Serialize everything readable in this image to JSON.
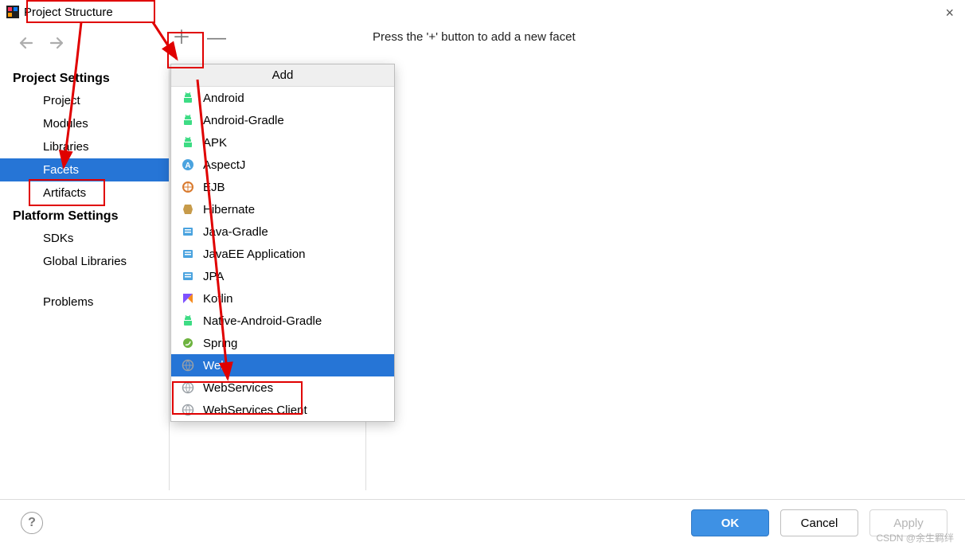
{
  "window": {
    "title": "Project Structure",
    "close_icon": "×"
  },
  "hint": "Press the '+' button to add a new facet",
  "sidebar": {
    "project_settings_heading": "Project Settings",
    "project": "Project",
    "modules": "Modules",
    "libraries": "Libraries",
    "facets": "Facets",
    "artifacts": "Artifacts",
    "platform_settings_heading": "Platform Settings",
    "sdks": "SDKs",
    "global_libraries": "Global Libraries",
    "problems": "Problems"
  },
  "popup": {
    "title": "Add",
    "items": [
      {
        "label": "Android",
        "icon_color": "#3ddc84",
        "icon": "android"
      },
      {
        "label": "Android-Gradle",
        "icon_color": "#3ddc84",
        "icon": "android"
      },
      {
        "label": "APK",
        "icon_color": "#3ddc84",
        "icon": "android"
      },
      {
        "label": "AspectJ",
        "icon_color": "#4aa3df",
        "icon": "letter-a"
      },
      {
        "label": "EJB",
        "icon_color": "#d97a2e",
        "icon": "ejb"
      },
      {
        "label": "Hibernate",
        "icon_color": "#c79b4a",
        "icon": "hibernate"
      },
      {
        "label": "Java-Gradle",
        "icon_color": "#4aa3df",
        "icon": "gradle"
      },
      {
        "label": "JavaEE Application",
        "icon_color": "#4aa3df",
        "icon": "javaee"
      },
      {
        "label": "JPA",
        "icon_color": "#4aa3df",
        "icon": "jpa"
      },
      {
        "label": "Kotlin",
        "icon_color": "#f68b1f",
        "icon": "kotlin"
      },
      {
        "label": "Native-Android-Gradle",
        "icon_color": "#3ddc84",
        "icon": "android"
      },
      {
        "label": "Spring",
        "icon_color": "#6db33f",
        "icon": "spring"
      },
      {
        "label": "Web",
        "icon_color": "#9aa0a6",
        "icon": "web",
        "selected": true
      },
      {
        "label": "WebServices",
        "icon_color": "#9aa0a6",
        "icon": "web"
      },
      {
        "label": "WebServices Client",
        "icon_color": "#9aa0a6",
        "icon": "web"
      }
    ]
  },
  "buttons": {
    "ok": "OK",
    "cancel": "Cancel",
    "apply": "Apply",
    "help": "?"
  },
  "watermark": "CSDN @余生羁绊",
  "annotations": {
    "arrow_color": "#e00000"
  }
}
